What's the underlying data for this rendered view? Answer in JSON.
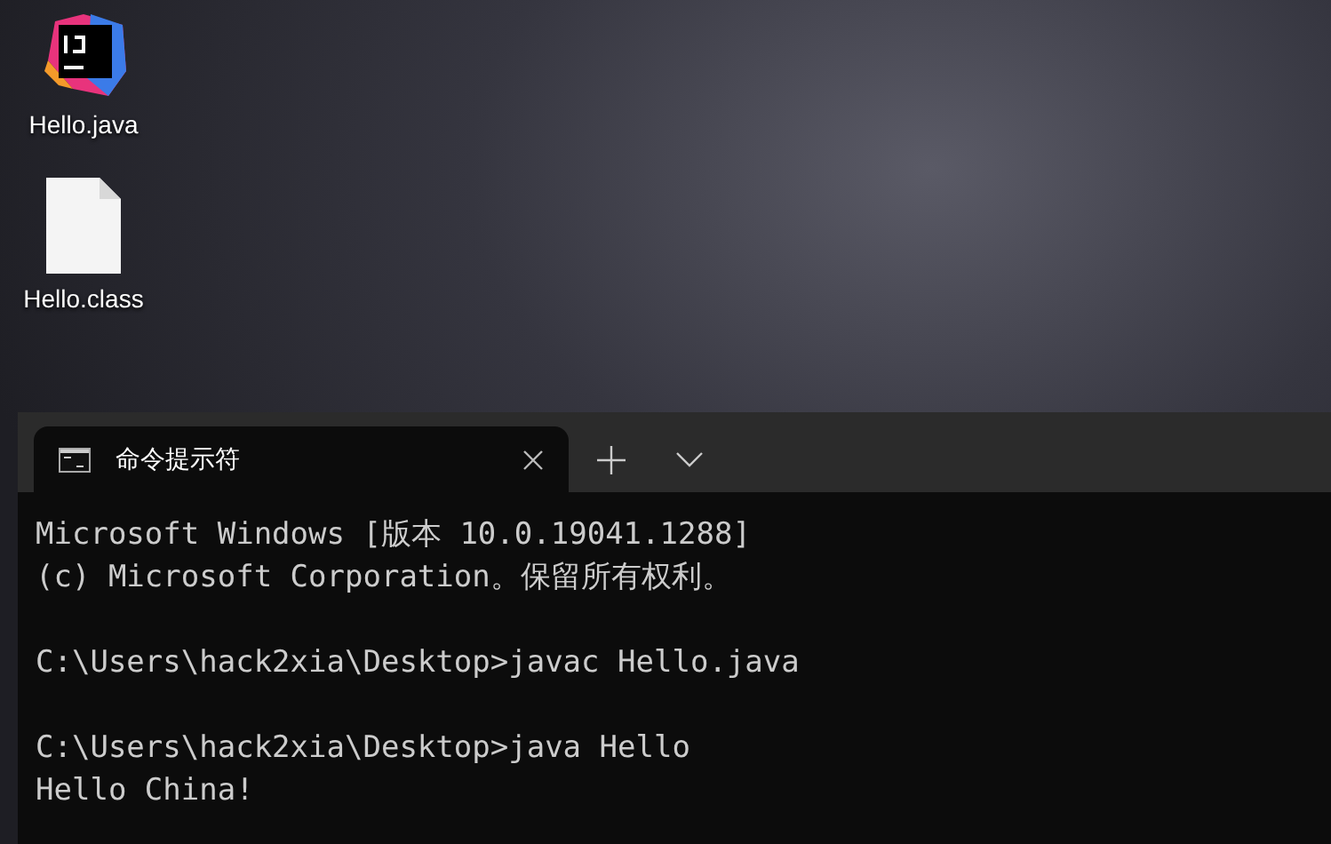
{
  "desktop": {
    "icons": [
      {
        "kind": "ide",
        "label": "Hello.java"
      },
      {
        "kind": "file",
        "label": "Hello.class"
      }
    ]
  },
  "terminal": {
    "tabs": [
      {
        "title": "命令提示符",
        "selected": true
      }
    ],
    "blocks": [
      [
        "Microsoft Windows [版本 10.0.19041.1288]",
        "(c) Microsoft Corporation。保留所有权利。"
      ],
      [
        "C:\\Users\\hack2xia\\Desktop>javac Hello.java"
      ],
      [
        "C:\\Users\\hack2xia\\Desktop>java Hello",
        "Hello China!"
      ]
    ]
  }
}
